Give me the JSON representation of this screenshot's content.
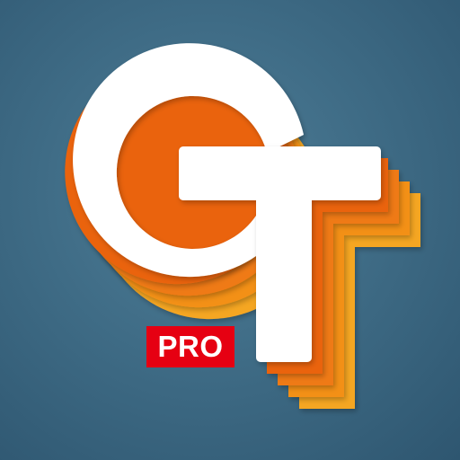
{
  "badge": {
    "text": "PRO"
  },
  "colors": {
    "background": "#3f6c86",
    "glyph": "#ffffff",
    "badge": "#e60012",
    "layers": [
      "#f5a623",
      "#f39017",
      "#ef7a12",
      "#ea6410"
    ]
  },
  "logo": {
    "letters_depicted": "GT"
  }
}
